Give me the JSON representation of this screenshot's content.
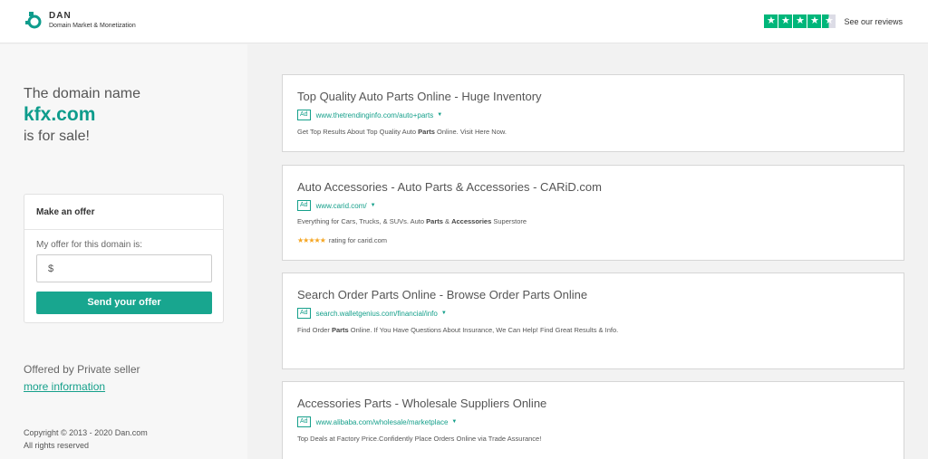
{
  "header": {
    "logo_name": "DAN",
    "logo_tagline": "Domain Market & Monetization",
    "reviews_link": "See our reviews",
    "trust_rating_stars": 4.5,
    "accent_color": "#00b67a"
  },
  "sale": {
    "prefix": "The domain name",
    "domain": "kfx.com",
    "suffix": "is for sale!"
  },
  "offer": {
    "title": "Make an offer",
    "label": "My offer for this domain is:",
    "input_placeholder": "$",
    "button_label": "Send your offer",
    "button_color": "#18a68f"
  },
  "seller": {
    "text": "Offered by Private seller",
    "link": "more information"
  },
  "footer": {
    "copyright": "Copyright © 2013 - 2020 Dan.com",
    "rights": "All rights reserved"
  },
  "ads": [
    {
      "title": "Top Quality Auto Parts Online - Huge Inventory",
      "badge": "Ad",
      "url": "www.thetrendinginfo.com/auto+parts",
      "desc_parts": [
        "Get Top Results About Top Quality Auto ",
        "Parts",
        " Online. Visit Here Now."
      ]
    },
    {
      "title": "Auto Accessories - Auto Parts & Accessories - CARiD.com",
      "badge": "Ad",
      "url": "www.carid.com/",
      "desc_parts": [
        "Everything for Cars, Trucks, & SUVs. Auto ",
        "Parts",
        " & ",
        "Accessories",
        " Superstore"
      ],
      "rating_text": "rating for carid.com",
      "rating_stars": 5
    },
    {
      "title": "Search Order Parts Online - Browse Order Parts Online",
      "badge": "Ad",
      "url": "search.walletgenius.com/financial/info",
      "desc_parts": [
        "Find Order ",
        "Parts",
        " Online. If You Have Questions About Insurance, We Can Help! Find Great Results & Info."
      ]
    },
    {
      "title": "Accessories Parts - Wholesale Suppliers Online",
      "badge": "Ad",
      "url": "www.alibaba.com/wholesale/marketplace",
      "desc_parts": [
        "Top Deals at Factory Price.Confidently Place Orders Online via Trade Assurance!"
      ]
    }
  ]
}
